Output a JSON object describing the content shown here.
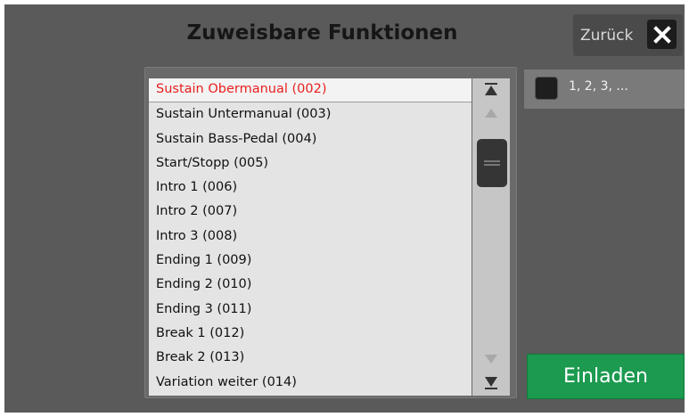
{
  "dialog": {
    "title": "Zuweisbare Funktionen",
    "back_label": "Zurück",
    "close_icon": "close-icon"
  },
  "list": {
    "items": [
      "Sustain Obermanual (002)",
      "Sustain Untermanual (003)",
      "Sustain Bass-Pedal (004)",
      "Start/Stopp (005)",
      "Intro 1 (006)",
      "Intro 2 (007)",
      "Intro 3 (008)",
      "Ending 1 (009)",
      "Ending 2 (010)",
      "Ending 3 (011)",
      "Break 1 (012)",
      "Break 2 (013)",
      "Variation weiter (014)"
    ],
    "selected_index": 0
  },
  "options": {
    "checkbox_label": "1, 2, 3, ...",
    "checked": false
  },
  "actions": {
    "load_label": "Einladen"
  },
  "colors": {
    "background": "#5a5a5a",
    "selected_text": "#e82020",
    "load_button": "#1b9a50"
  }
}
